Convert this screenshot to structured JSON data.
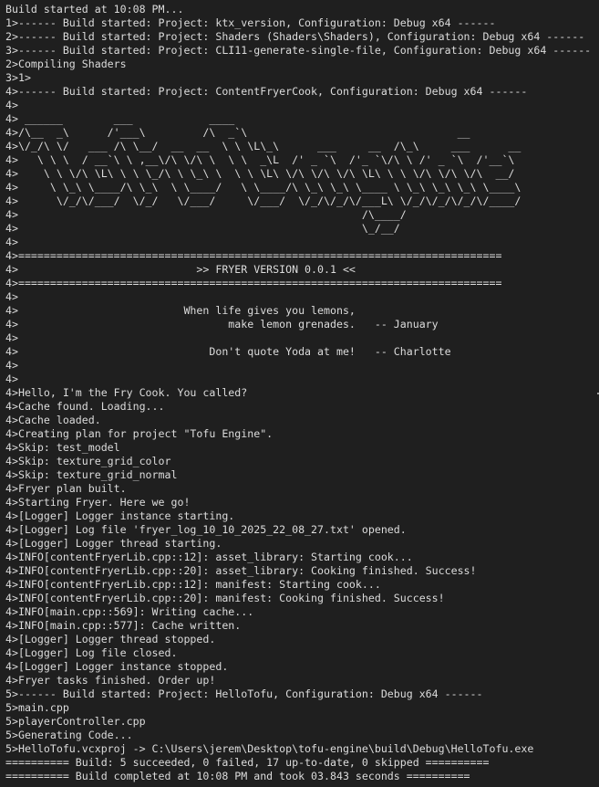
{
  "output": {
    "lines": [
      "Build started at 10:08 PM...",
      "1>------ Build started: Project: ktx_version, Configuration: Debug x64 ------",
      "2>------ Build started: Project: Shaders (Shaders\\Shaders), Configuration: Debug x64 ------",
      "3>------ Build started: Project: CLI11-generate-single-file, Configuration: Debug x64 ------",
      "2>Compiling Shaders",
      "3>1>",
      "4>------ Build started: Project: ContentFryerCook, Configuration: Debug x64 ------",
      "4>",
      "4> ______        ___            ____",
      "4>/\\__  _\\      /'___\\         /\\  _`\\                                 __",
      "4>\\/_/\\ \\/   ___ /\\ \\__/  __  __  \\ \\ \\L\\_\\      ___     __  /\\_\\     ___      __",
      "4>   \\ \\ \\  / __`\\ \\ ,__\\/\\ \\/\\ \\  \\ \\  _\\L  /' _ `\\  /'_ `\\/\\ \\ /' _ `\\  /'__`\\",
      "4>    \\ \\ \\/\\ \\L\\ \\ \\ \\_/\\ \\ \\_\\ \\  \\ \\ \\L\\ \\/\\ \\/\\ \\/\\ \\L\\ \\ \\ \\/\\ \\/\\ \\/\\  __/",
      "4>     \\ \\_\\ \\____/\\ \\_\\  \\ \\____/   \\ \\____/\\ \\_\\ \\_\\ \\____ \\ \\_\\ \\_\\ \\_\\ \\____\\",
      "4>      \\/_/\\/___/  \\/_/   \\/___/     \\/___/  \\/_/\\/_/\\/___L\\ \\/_/\\/_/\\/_/\\/____/",
      "4>                                                      /\\____/",
      "4>                                                      \\_/__/",
      "4>",
      "4>============================================================================",
      "4>                            >> FRYER VERSION 0.0.1 <<",
      "4>============================================================================",
      "4>",
      "4>                          When life gives you lemons,",
      "4>                                 make lemon grenades.   -- January",
      "4>",
      "4>                              Don't quote Yoda at me!   -- Charlotte",
      "4>",
      "4>",
      "4>Hello, I'm the Fry Cook. You called?",
      "4>Cache found. Loading...",
      "4>Cache loaded.",
      "4>Creating plan for project \"Tofu Engine\".",
      "4>Skip: test_model",
      "4>Skip: texture_grid_color",
      "4>Skip: texture_grid_normal",
      "4>Fryer plan built.",
      "4>Starting Fryer. Here we go!",
      "4>[Logger] Logger instance starting.",
      "4>[Logger] Log file 'fryer_log_10_10_2025_22_08_27.txt' opened.",
      "4>[Logger] Logger thread starting.",
      "4>INFO[contentFryerLib.cpp::12]: asset_library: Starting cook...",
      "4>INFO[contentFryerLib.cpp::20]: asset_library: Cooking finished. Success!",
      "4>INFO[contentFryerLib.cpp::12]: manifest: Starting cook...",
      "4>INFO[contentFryerLib.cpp::20]: manifest: Cooking finished. Success!",
      "4>INFO[main.cpp::569]: Writing cache...",
      "4>INFO[main.cpp::577]: Cache written.",
      "4>[Logger] Logger thread stopped.",
      "4>[Logger] Log file closed.",
      "4>[Logger] Logger instance stopped.",
      "4>Fryer tasks finished. Order up!",
      "5>------ Build started: Project: HelloTofu, Configuration: Debug x64 ------",
      "5>main.cpp",
      "5>playerController.cpp",
      "5>Generating Code...",
      "5>HelloTofu.vcxproj -> C:\\Users\\jerem\\Desktop\\tofu-engine\\build\\Debug\\HelloTofu.exe",
      "========== Build: 5 succeeded, 0 failed, 17 up-to-date, 0 skipped ==========",
      "========== Build completed at 10:08 PM and took 03.843 seconds =========="
    ]
  },
  "colors": {
    "background": "#1f1f1f",
    "text": "#dcdcdc"
  }
}
